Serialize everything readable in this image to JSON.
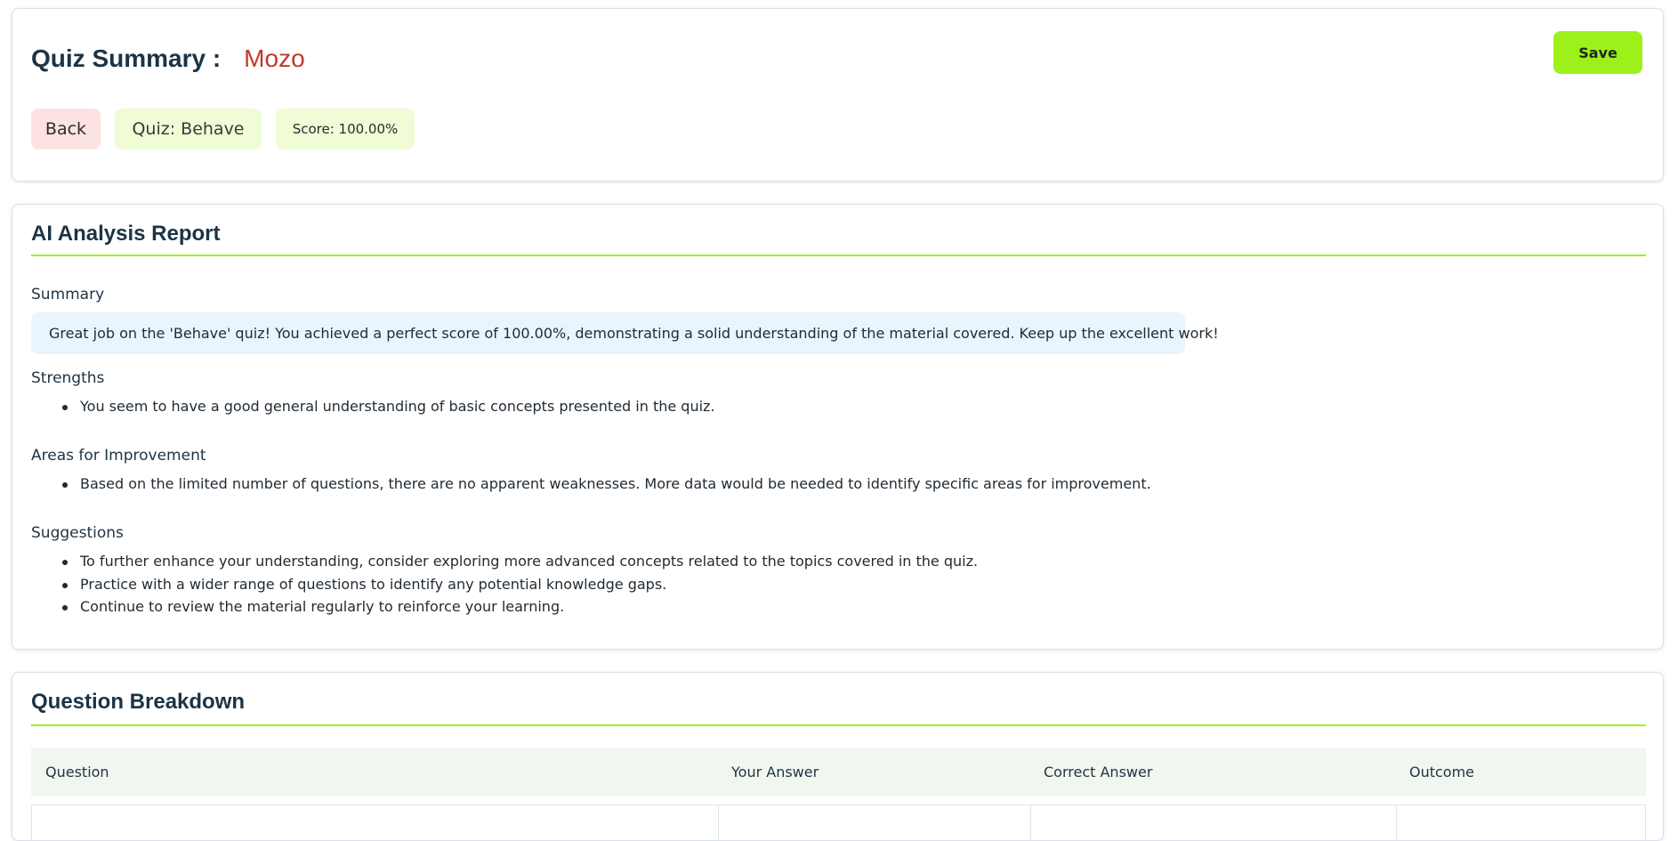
{
  "header": {
    "title_label": "Quiz Summary :",
    "user_name": "Mozo",
    "save_label": "Save",
    "back_label": "Back",
    "quiz_chip": "Quiz: Behave",
    "score_chip": "Score: 100.00%"
  },
  "analysis": {
    "title": "AI Analysis Report",
    "summary_heading": "Summary",
    "summary_text": "Great job on the 'Behave' quiz! You achieved a perfect score of 100.00%, demonstrating a solid understanding of the material covered. Keep up the excellent work!",
    "strengths_heading": "Strengths",
    "strengths": [
      "You seem to have a good general understanding of basic concepts presented in the quiz."
    ],
    "improvement_heading": "Areas for Improvement",
    "improvements": [
      "Based on the limited number of questions, there are no apparent weaknesses. More data would be needed to identify specific areas for improvement."
    ],
    "suggestions_heading": "Suggestions",
    "suggestions": [
      "To further enhance your understanding, consider exploring more advanced concepts related to the topics covered in the quiz.",
      "Practice with a wider range of questions to identify any potential knowledge gaps.",
      "Continue to review the material regularly to reinforce your learning."
    ]
  },
  "breakdown": {
    "title": "Question Breakdown",
    "columns": [
      "Question",
      "Your Answer",
      "Correct Answer",
      "Outcome"
    ]
  },
  "colors": {
    "accent": "#9ef01a",
    "name_red": "#c0392b",
    "heading": "#1b3446"
  }
}
